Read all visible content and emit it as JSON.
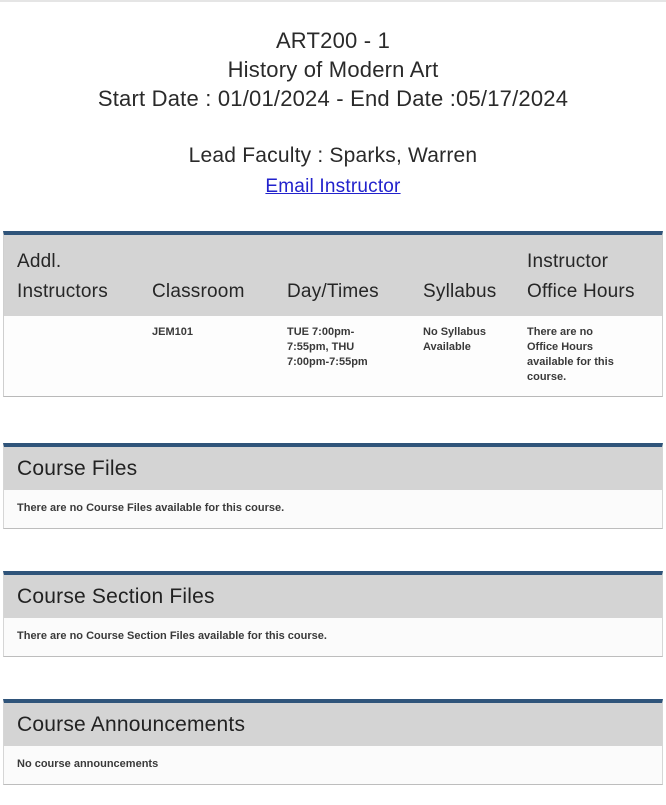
{
  "header": {
    "course_code": "ART200 - 1",
    "course_title": "History of Modern Art",
    "date_line": "Start Date : 01/01/2024 -  End Date :05/17/2024",
    "lead_faculty": "Lead Faculty : Sparks, Warren",
    "email_link_label": "Email Instructor"
  },
  "colors": {
    "accent_navy": "#2f547a",
    "header_gray": "#d4d4d4",
    "link_blue": "#2222cc"
  },
  "info_table": {
    "columns": [
      "Addl. Instructors",
      "Classroom",
      "Day/Times",
      "Syllabus",
      "Instructor Office Hours"
    ],
    "row": {
      "addl_instructors": "",
      "classroom": "JEM101",
      "day_times": "TUE 7:00pm-7:55pm, THU 7:00pm-7:55pm",
      "syllabus": "No Syllabus Available",
      "office_hours": "There are no Office Hours available for this course."
    }
  },
  "sections": [
    {
      "title": "Course Files",
      "body": "There are no Course Files available for this course."
    },
    {
      "title": "Course Section Files",
      "body": "There are no Course Section Files available for this course."
    },
    {
      "title": "Course Announcements",
      "body": "No course announcements"
    }
  ]
}
